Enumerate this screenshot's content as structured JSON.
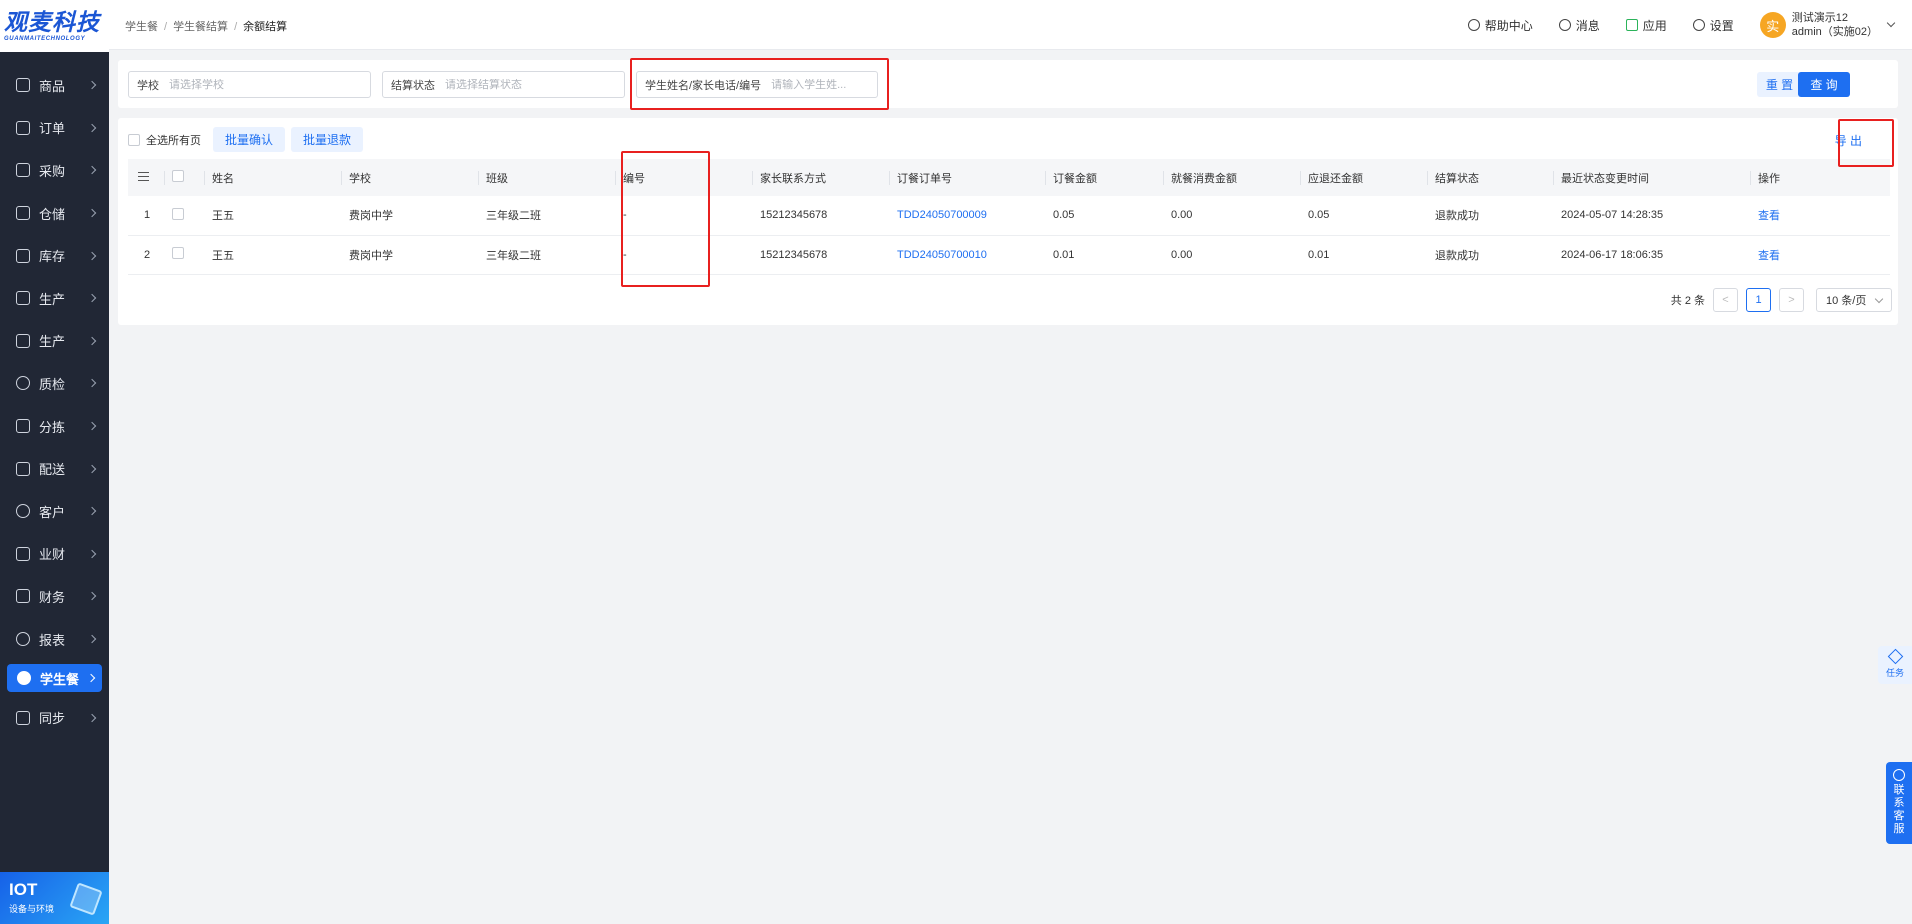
{
  "logo": {
    "main": "观麦科技",
    "sub": "GUANMAITECHNOLOGY"
  },
  "nav": [
    {
      "label": "商品",
      "icon": "grid-icon"
    },
    {
      "label": "订单",
      "icon": "clipboard-icon"
    },
    {
      "label": "采购",
      "icon": "basket-icon"
    },
    {
      "label": "仓储",
      "icon": "warehouse-icon"
    },
    {
      "label": "库存",
      "icon": "inventory-icon"
    },
    {
      "label": "生产",
      "icon": "factory-icon"
    },
    {
      "label": "生产",
      "icon": "factory-icon"
    },
    {
      "label": "质检",
      "icon": "shield-icon"
    },
    {
      "label": "分拣",
      "icon": "sort-icon"
    },
    {
      "label": "配送",
      "icon": "truck-icon"
    },
    {
      "label": "客户",
      "icon": "user-icon"
    },
    {
      "label": "业财",
      "icon": "bar-chart-icon"
    },
    {
      "label": "财务",
      "icon": "finance-icon"
    },
    {
      "label": "报表",
      "icon": "pie-icon"
    },
    {
      "label": "学生餐",
      "icon": "cloud-icon"
    },
    {
      "label": "同步",
      "icon": "sync-icon"
    }
  ],
  "iot": {
    "title": "IOT",
    "subtitle": "设备与环境"
  },
  "breadcrumb": [
    "学生餐",
    "学生餐结算",
    "余额结算"
  ],
  "header": {
    "help": "帮助中心",
    "messages": "消息",
    "apps": "应用",
    "settings": "设置",
    "avatar": "实",
    "user_name": "测试演示12",
    "user_account": "admin（实施02）"
  },
  "filters": {
    "school_label": "学校",
    "school_placeholder": "请选择学校",
    "status_label": "结算状态",
    "status_placeholder": "请选择结算状态",
    "student_label": "学生姓名/家长电话/编号",
    "student_placeholder": "请输入学生姓...",
    "reset": "重 置",
    "query": "查 询"
  },
  "toolbar": {
    "select_all": "全选所有页",
    "batch_confirm": "批量确认",
    "batch_refund": "批量退款",
    "export": "导 出"
  },
  "table": {
    "columns": [
      "姓名",
      "学校",
      "班级",
      "编号",
      "家长联系方式",
      "订餐订单号",
      "订餐金额",
      "就餐消费金额",
      "应退还金额",
      "结算状态",
      "最近状态变更时间",
      "操作"
    ],
    "rows": [
      {
        "idx": "1",
        "name": "王五",
        "school": "费岗中学",
        "class": "三年级二班",
        "code": "-",
        "phone": "15212345678",
        "order": "TDD24050700009",
        "amount": "0.05",
        "consumed": "0.00",
        "refund": "0.05",
        "status": "退款成功",
        "time": "2024-05-07 14:28:35",
        "action": "查看"
      },
      {
        "idx": "2",
        "name": "王五",
        "school": "费岗中学",
        "class": "三年级二班",
        "code": "-",
        "phone": "15212345678",
        "order": "TDD24050700010",
        "amount": "0.01",
        "consumed": "0.00",
        "refund": "0.01",
        "status": "退款成功",
        "time": "2024-06-17 18:06:35",
        "action": "查看"
      }
    ]
  },
  "pager": {
    "total": "共 2 条",
    "current": "1",
    "prev": "<",
    "next": ">",
    "size": "10 条/页"
  },
  "floats": {
    "task": "任务",
    "service": [
      "联",
      "系",
      "客",
      "服"
    ]
  },
  "colors": {
    "primary": "#1e6ff1",
    "sidebar": "#212735",
    "annotation": "#e8201f"
  }
}
